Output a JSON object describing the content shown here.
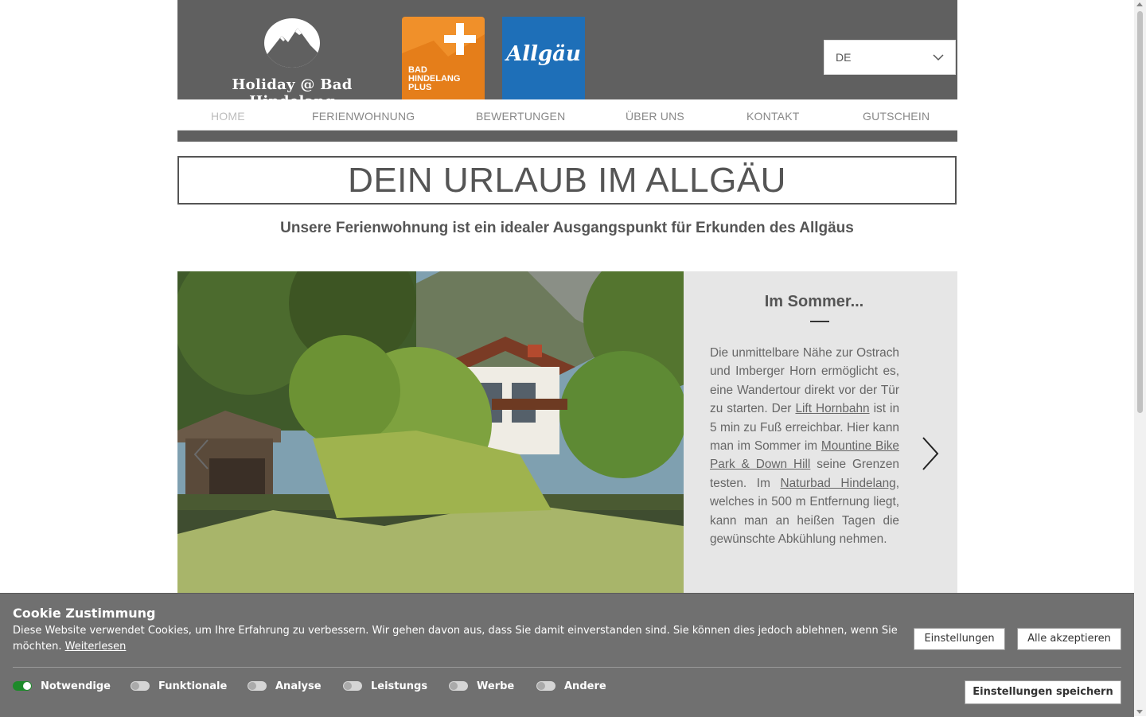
{
  "header": {
    "logo_text": "Holiday @ Bad Hindelang",
    "badge_bad_hindelang": [
      "BAD",
      "HINDELANG",
      "PLUS"
    ],
    "badge_allgau": "Allgäu",
    "language": "DE"
  },
  "nav": {
    "items": [
      "HOME",
      "FERIENWOHNUNG",
      "BEWERTUNGEN",
      "ÜBER UNS",
      "KONTAKT",
      "GUTSCHEIN"
    ]
  },
  "main": {
    "title": "DEIN URLAUB IM ALLGÄU",
    "subtitle": "Unsere Ferienwohnung ist ein idealer Ausgangspunkt für Erkunden des Allgäus"
  },
  "slide": {
    "heading": "Im Sommer...",
    "t1": "Die unmittelbare Nähe zur Ostrach und Imberger Horn ermöglicht es, eine Wandertour direkt vor der Tür zu starten. Der ",
    "link1": "Lift Hornbahn",
    "t2": " ist in 5 min zu Fuß erreichbar. Hier kann man im Sommer im ",
    "link2": "Mountine Bike Park & Down Hill",
    "t3": " seine Grenzen testen. Im ",
    "link3": "Naturbad Hindelang",
    "t4": ", welches in 500 m Entfernung liegt, kann man an heißen Tagen die gewünschte Abkühlung nehmen."
  },
  "cookie": {
    "title": "Cookie Zustimmung",
    "text": "Diese Website verwendet Cookies, um Ihre Erfahrung zu verbessern. Wir gehen davon aus, dass Sie damit einverstanden sind. Sie können dies jedoch ablehnen, wenn Sie möchten. ",
    "read_more": "Weiterlesen",
    "settings_button": "Einstellungen",
    "accept_all_button": "Alle akzeptieren",
    "save_button": "Einstellungen speichern",
    "toggles": [
      {
        "label": "Notwendige",
        "on": true
      },
      {
        "label": "Funktionale",
        "on": false
      },
      {
        "label": "Analyse",
        "on": false
      },
      {
        "label": "Leistungs",
        "on": false
      },
      {
        "label": "Werbe",
        "on": false
      },
      {
        "label": "Andere",
        "on": false
      }
    ]
  },
  "colors": {
    "header_bg": "#606060",
    "badge_orange": "#f0902a",
    "badge_blue": "#1e6fb8",
    "toggle_on": "#1e8a2a",
    "cookie_bg": "#707070"
  }
}
